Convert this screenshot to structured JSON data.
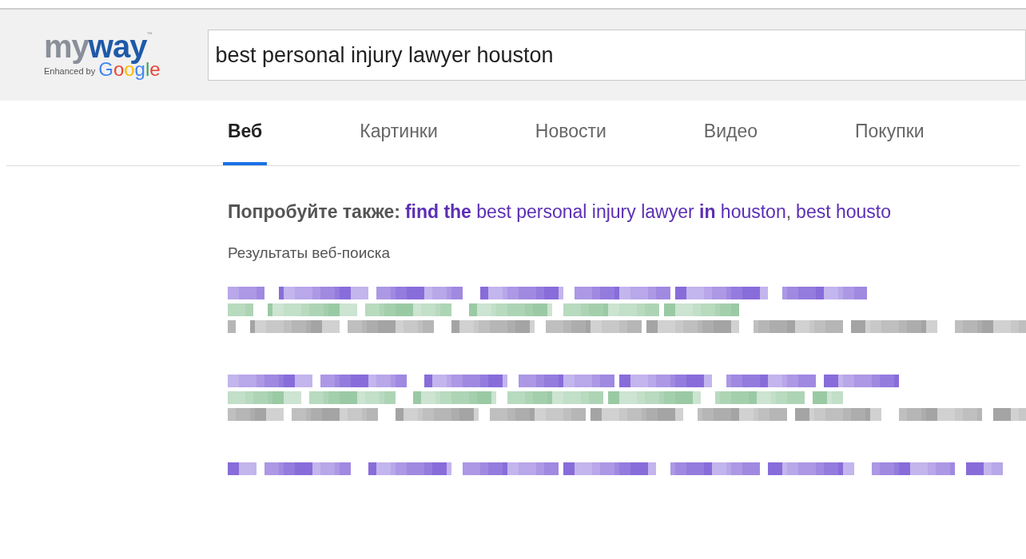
{
  "logo": {
    "name_parts": [
      "my",
      "way"
    ],
    "trademark": "™",
    "enhanced_by": "Enhanced by",
    "google": "Google"
  },
  "search": {
    "value": "best personal injury lawyer houston"
  },
  "tabs": [
    {
      "label": "Веб",
      "selected": true
    },
    {
      "label": "Картинки",
      "selected": false
    },
    {
      "label": "Новости",
      "selected": false
    },
    {
      "label": "Видео",
      "selected": false
    },
    {
      "label": "Покупки",
      "selected": false
    }
  ],
  "suggestions": {
    "label": "Попробуйте также:",
    "separator": ",",
    "links": [
      "**find the** best personal injury lawyer **in** houston",
      "best housto"
    ]
  },
  "results_heading": "Результаты веб-поиска",
  "results": [
    {
      "kind": "full"
    },
    {
      "kind": "full"
    },
    {
      "kind": "title_only"
    }
  ]
}
